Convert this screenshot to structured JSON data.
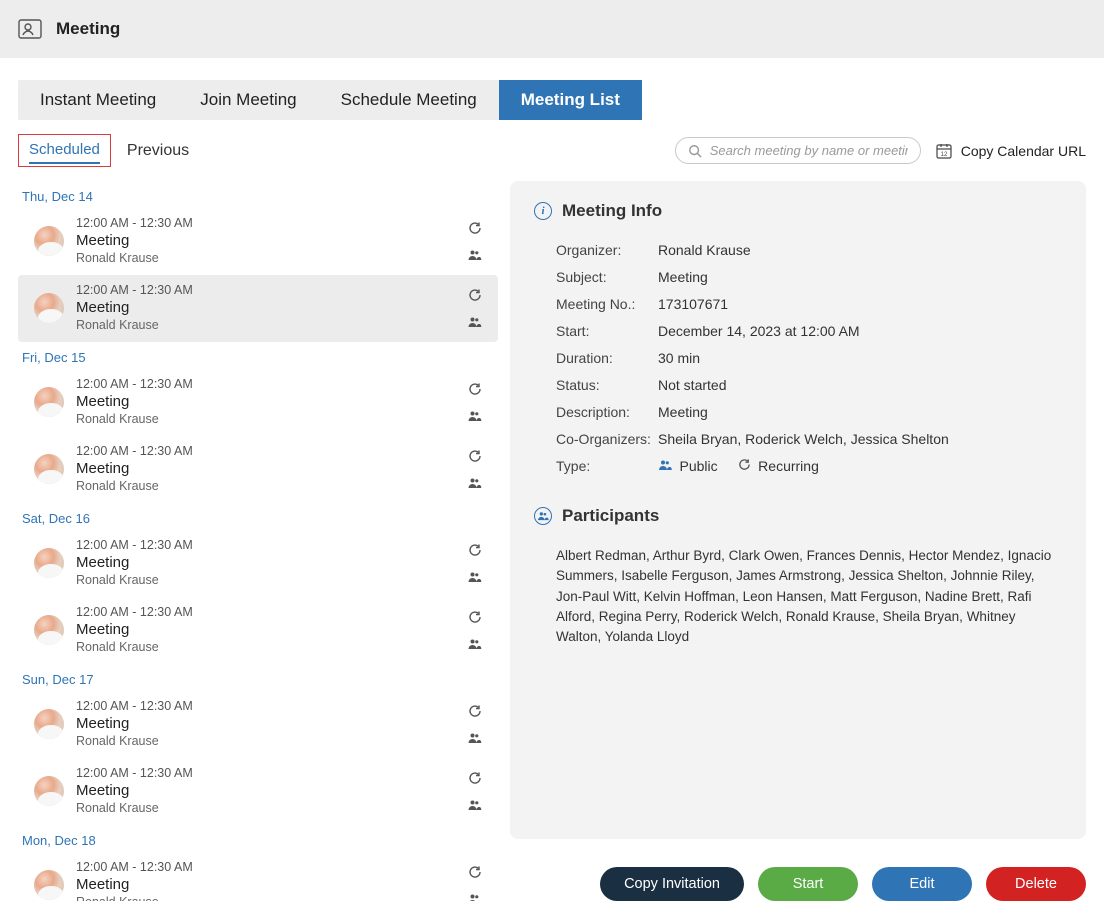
{
  "header": {
    "title": "Meeting"
  },
  "tabs": {
    "instant": "Instant Meeting",
    "join": "Join Meeting",
    "schedule": "Schedule Meeting",
    "list": "Meeting List"
  },
  "sub": {
    "scheduled": "Scheduled",
    "previous": "Previous",
    "search_placeholder": "Search meeting by name or meeting nu",
    "copy_url": "Copy Calendar URL"
  },
  "dates": [
    {
      "label": "Thu, Dec 14",
      "items": [
        {
          "time": "12:00 AM - 12:30 AM",
          "title": "Meeting",
          "organizer": "Ronald Krause",
          "selected": false
        },
        {
          "time": "12:00 AM - 12:30 AM",
          "title": "Meeting",
          "organizer": "Ronald Krause",
          "selected": true
        }
      ]
    },
    {
      "label": "Fri, Dec 15",
      "items": [
        {
          "time": "12:00 AM - 12:30 AM",
          "title": "Meeting",
          "organizer": "Ronald Krause",
          "selected": false
        },
        {
          "time": "12:00 AM - 12:30 AM",
          "title": "Meeting",
          "organizer": "Ronald Krause",
          "selected": false
        }
      ]
    },
    {
      "label": "Sat, Dec 16",
      "items": [
        {
          "time": "12:00 AM - 12:30 AM",
          "title": "Meeting",
          "organizer": "Ronald Krause",
          "selected": false
        },
        {
          "time": "12:00 AM - 12:30 AM",
          "title": "Meeting",
          "organizer": "Ronald Krause",
          "selected": false
        }
      ]
    },
    {
      "label": "Sun, Dec 17",
      "items": [
        {
          "time": "12:00 AM - 12:30 AM",
          "title": "Meeting",
          "organizer": "Ronald Krause",
          "selected": false
        },
        {
          "time": "12:00 AM - 12:30 AM",
          "title": "Meeting",
          "organizer": "Ronald Krause",
          "selected": false
        }
      ]
    },
    {
      "label": "Mon, Dec 18",
      "items": [
        {
          "time": "12:00 AM - 12:30 AM",
          "title": "Meeting",
          "organizer": "Ronald Krause",
          "selected": false
        }
      ]
    }
  ],
  "info": {
    "heading": "Meeting Info",
    "labels": {
      "organizer": "Organizer:",
      "subject": "Subject:",
      "meeting_no": "Meeting No.:",
      "start": "Start:",
      "duration": "Duration:",
      "status": "Status:",
      "description": "Description:",
      "co_organizers": "Co-Organizers:",
      "type": "Type:"
    },
    "values": {
      "organizer": "Ronald Krause",
      "subject": "Meeting",
      "meeting_no": "173107671",
      "start": "December 14, 2023 at 12:00 AM",
      "duration": "30 min",
      "status": "Not started",
      "description": "Meeting",
      "co_organizers": "Sheila Bryan, Roderick Welch, Jessica Shelton",
      "type_public": "Public",
      "type_recurring": "Recurring"
    }
  },
  "participants": {
    "heading": "Participants",
    "text": "Albert Redman, Arthur Byrd, Clark Owen, Frances Dennis, Hector Mendez, Ignacio Summers, Isabelle Ferguson, James Armstrong, Jessica Shelton, Johnnie Riley, Jon-Paul Witt, Kelvin Hoffman, Leon Hansen, Matt Ferguson, Nadine Brett, Rafi Alford, Regina Perry, Roderick Welch, Ronald Krause, Sheila Bryan, Whitney Walton, Yolanda Lloyd"
  },
  "actions": {
    "copy": "Copy Invitation",
    "start": "Start",
    "edit": "Edit",
    "delete": "Delete"
  }
}
